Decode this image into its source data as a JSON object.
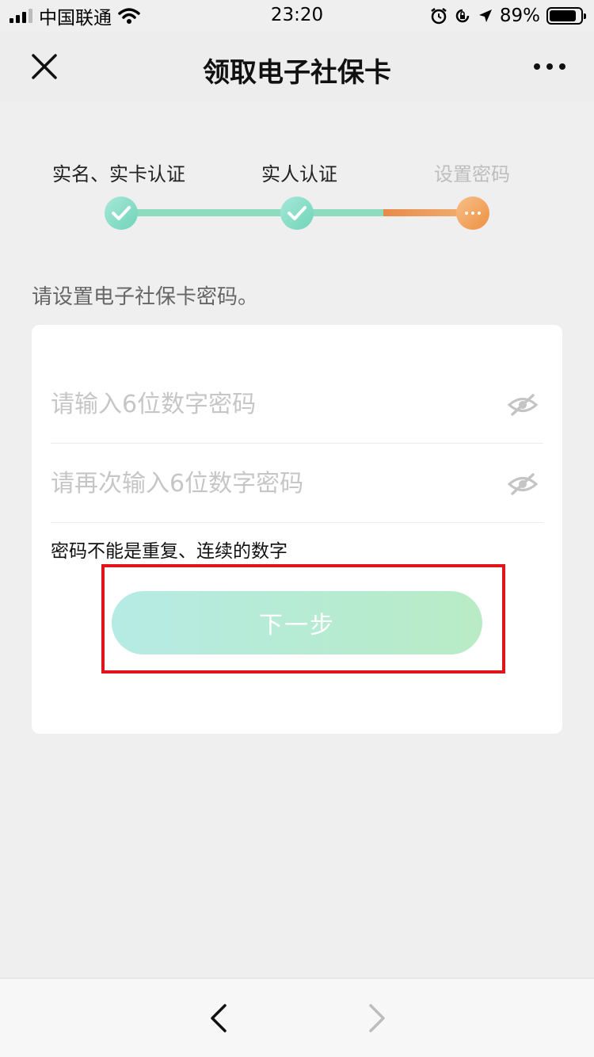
{
  "status_bar": {
    "carrier": "中国联通",
    "time": "23:20",
    "battery": "89%"
  },
  "nav": {
    "title": "领取电子社保卡",
    "close_icon": "close-icon",
    "more_icon": "more-icon"
  },
  "steps": [
    {
      "label": "实名、实卡认证",
      "state": "done"
    },
    {
      "label": "实人认证",
      "state": "done"
    },
    {
      "label": "设置密码",
      "state": "current"
    }
  ],
  "form": {
    "prompt": "请设置电子社保卡密码。",
    "password_placeholder": "请输入6位数字密码",
    "password_value": "",
    "confirm_placeholder": "请再次输入6位数字密码",
    "confirm_value": "",
    "hint": "密码不能是重复、连续的数字",
    "next_label": "下一步"
  },
  "colors": {
    "step_done": "#6fd4b8",
    "step_current": "#ee9040",
    "highlight": "#e0141b"
  }
}
